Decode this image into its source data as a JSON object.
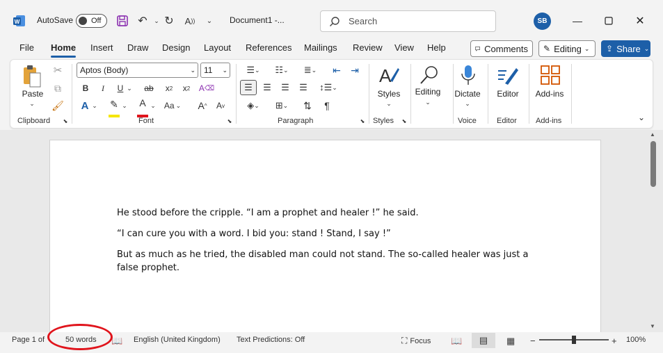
{
  "titlebar": {
    "autosave_label": "AutoSave",
    "autosave_state": "Off",
    "doc_title": "Document1  -...",
    "search_placeholder": "Search",
    "avatar_initials": "SB"
  },
  "tabs": [
    "File",
    "Home",
    "Insert",
    "Draw",
    "Design",
    "Layout",
    "References",
    "Mailings",
    "Review",
    "View",
    "Help"
  ],
  "active_tab": "Home",
  "toolbar_buttons": {
    "comments": "Comments",
    "editing": "Editing",
    "share": "Share"
  },
  "ribbon": {
    "clipboard": {
      "paste_label": "Paste",
      "group_label": "Clipboard"
    },
    "font": {
      "font_name": "Aptos (Body)",
      "font_size": "11",
      "group_label": "Font"
    },
    "paragraph": {
      "group_label": "Paragraph"
    },
    "styles": {
      "button_label": "Styles",
      "group_label": "Styles"
    },
    "editing": {
      "button_label": "Editing"
    },
    "voice": {
      "button_label": "Dictate",
      "group_label": "Voice"
    },
    "editor": {
      "button_label": "Editor",
      "group_label": "Editor"
    },
    "addins": {
      "button_label": "Add-ins",
      "group_label": "Add-ins"
    }
  },
  "document": {
    "paragraphs": [
      "He stood before the cripple. “I am a prophet and healer !” he said.",
      "“I can cure you with a word. I bid you: stand ! Stand, I say !”",
      "But as much as he tried, the disabled man could not stand. The so-called healer was just a false prophet."
    ]
  },
  "statusbar": {
    "page": "Page 1 of",
    "words": "50 words",
    "language": "English (United Kingdom)",
    "text_predictions": "Text Predictions: Off",
    "focus": "Focus",
    "zoom": "100%"
  },
  "colors": {
    "accent": "#1d5fa8",
    "highlight_ellipse": "#e0141c",
    "font_color_bar": "#e0141c",
    "highlight_bar": "#f5e600"
  }
}
